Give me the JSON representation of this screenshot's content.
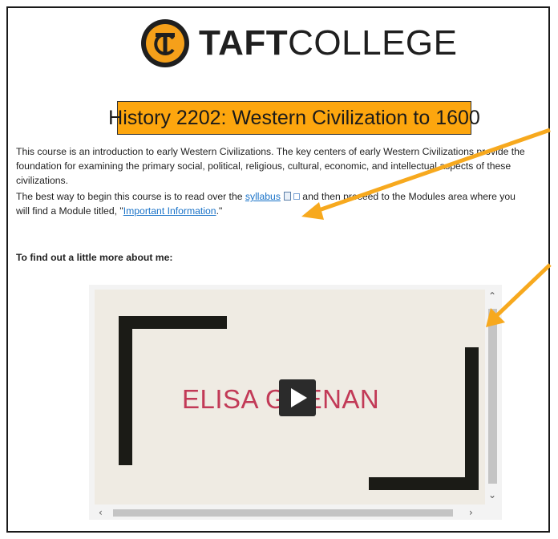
{
  "logo": {
    "word_bold": "TAFT",
    "word_regular": "COLLEGE",
    "seal_monogram": "TC"
  },
  "course_title": "History 2202: Western Civilization to 1600",
  "intro": "This course is an introduction to early Western Civilizations. The key centers of early Western Civilizations provide the foundation for examining the primary social, political, religious, cultural, economic, and intellectual aspects of these civilizations.",
  "begin": {
    "before": "The best way to begin this course is to read over the ",
    "syllabus_link": "syllabus",
    "middle": " and then proceed to the Modules area where you will find a Module titled, \"",
    "module_link": "Important Information",
    "after": ".\""
  },
  "about_heading": "To find out a little more about me:",
  "video": {
    "name_text": "ELISA GEENAN"
  },
  "icons": {
    "file": "document-icon",
    "external": "external-link-icon",
    "play": "play-icon",
    "scroll_up": "chevron-up-icon",
    "scroll_down": "chevron-down-icon",
    "scroll_left": "chevron-left-icon",
    "scroll_right": "chevron-right-icon"
  },
  "colors": {
    "brand_orange": "#fda60e",
    "link": "#1a73c8",
    "annotation_arrow": "#f7a91e",
    "video_name": "#c23a57"
  }
}
